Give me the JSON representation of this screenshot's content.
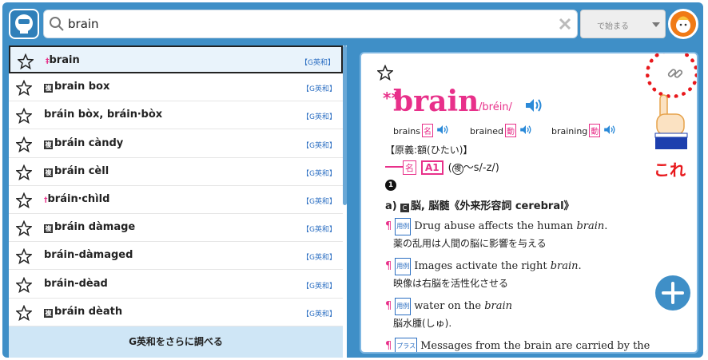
{
  "search": {
    "value": "brain",
    "mode_label": "で始まる"
  },
  "results": {
    "items": [
      {
        "prefix": "‡",
        "text": "brain",
        "tag": "【G英和】",
        "compound": false,
        "selected": true
      },
      {
        "prefix": "",
        "text": "brain box",
        "tag": "【G英和】",
        "compound": true,
        "selected": false
      },
      {
        "prefix": "",
        "text": "bráin bòx, bráin‧bòx",
        "tag": "【G英和】",
        "compound": false,
        "selected": false
      },
      {
        "prefix": "",
        "text": "bráin càndy",
        "tag": "【G英和】",
        "compound": true,
        "selected": false
      },
      {
        "prefix": "",
        "text": "bráin cèll",
        "tag": "【G英和】",
        "compound": true,
        "selected": false
      },
      {
        "prefix": "†",
        "text": "bráin‧chìld",
        "tag": "【G英和】",
        "compound": false,
        "selected": false
      },
      {
        "prefix": "",
        "text": "bráin dàmage",
        "tag": "【G英和】",
        "compound": true,
        "selected": false
      },
      {
        "prefix": "",
        "text": "bráin-dàmaged",
        "tag": "【G英和】",
        "compound": false,
        "selected": false
      },
      {
        "prefix": "",
        "text": "bráin-dèad",
        "tag": "【G英和】",
        "compound": false,
        "selected": false
      },
      {
        "prefix": "",
        "text": "bráin dèath",
        "tag": "【G英和】",
        "compound": true,
        "selected": false
      }
    ],
    "more_label": "G英和をさらに調べる"
  },
  "entry": {
    "headword": "brain",
    "headword_mark": "**",
    "pronunciation": "/bréin/",
    "inflections": [
      {
        "form": "brains",
        "pos": "名"
      },
      {
        "form": "brained",
        "pos": "動"
      },
      {
        "form": "braining",
        "pos": "動"
      }
    ],
    "etymology": "【原義:額(ひたい)】",
    "pos_label": "名",
    "level": "A1",
    "plural_mark": "複",
    "plural_note": "〜s/-z/",
    "sense_number": "1",
    "sense_a_label": "a)",
    "sense_a_countable": "C",
    "sense_a_text": "脳, 脳髄《外来形容詞 cerebral》",
    "examples": [
      {
        "label": "用例",
        "en_pre": "Drug abuse affects the human ",
        "en_em": "brain",
        "en_post": ".",
        "ja": "薬の乱用は人間の脳に影響を与える"
      },
      {
        "label": "用例",
        "en_pre": "Images activate the right ",
        "en_em": "brain",
        "en_post": ".",
        "ja": "映像は右脳を活性化させる"
      },
      {
        "label": "用例",
        "en_pre": "water on the ",
        "en_em": "brain",
        "en_post": "",
        "ja": "脳水腫(しゅ)."
      },
      {
        "label": "プラス",
        "en_pre": "Messages from the brain are carried by the",
        "en_em": "",
        "en_post": "",
        "ja": ""
      }
    ],
    "pilcrow": "¶"
  },
  "annotation": {
    "label": "これ",
    "color": "#e8181c"
  },
  "colors": {
    "accent": "#3f8fc7",
    "pink": "#e8308a",
    "link": "#2b6ec2"
  }
}
